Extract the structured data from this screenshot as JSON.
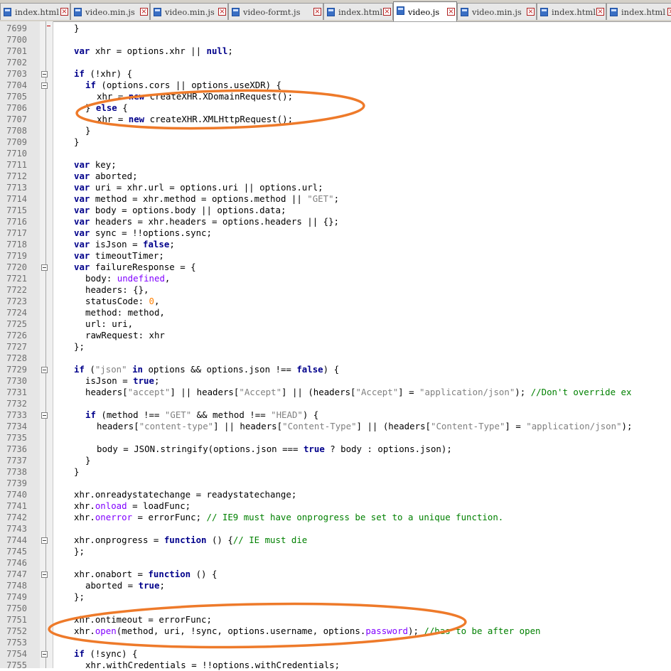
{
  "tabs": [
    {
      "name": "index.html",
      "active": false
    },
    {
      "name": "video.min.js",
      "active": false
    },
    {
      "name": "video.min.js",
      "active": false
    },
    {
      "name": "video-formt.js",
      "active": false
    },
    {
      "name": "index.html",
      "active": false
    },
    {
      "name": "video.js",
      "active": true
    },
    {
      "name": "video.min.js",
      "active": false
    },
    {
      "name": "index.html",
      "active": false
    },
    {
      "name": "index.html",
      "active": false
    }
  ],
  "tab_close_glyph": "×",
  "lines": [
    {
      "n": "7699",
      "indent": 1,
      "tokens": [
        [
          "p",
          "}"
        ]
      ]
    },
    {
      "n": "7700",
      "indent": 0,
      "tokens": []
    },
    {
      "n": "7701",
      "indent": 1,
      "tokens": [
        [
          "k",
          "var"
        ],
        [
          "p",
          " xhr = options.xhr || "
        ],
        [
          "k",
          "null"
        ],
        [
          "p",
          ";"
        ]
      ]
    },
    {
      "n": "7702",
      "indent": 0,
      "tokens": []
    },
    {
      "n": "7703",
      "indent": 1,
      "fold": true,
      "tokens": [
        [
          "k",
          "if"
        ],
        [
          "p",
          " (!xhr) {"
        ]
      ]
    },
    {
      "n": "7704",
      "indent": 2,
      "fold": true,
      "tokens": [
        [
          "k",
          "if"
        ],
        [
          "p",
          " (options.cors || options.useXDR) {"
        ]
      ]
    },
    {
      "n": "7705",
      "indent": 3,
      "tokens": [
        [
          "p",
          "xhr = "
        ],
        [
          "k",
          "new"
        ],
        [
          "p",
          " createXHR.XDomainRequest();"
        ]
      ]
    },
    {
      "n": "7706",
      "indent": 2,
      "tokens": [
        [
          "p",
          "} "
        ],
        [
          "k",
          "else"
        ],
        [
          "p",
          " {"
        ]
      ]
    },
    {
      "n": "7707",
      "indent": 3,
      "tokens": [
        [
          "p",
          "xhr = "
        ],
        [
          "k",
          "new"
        ],
        [
          "p",
          " createXHR.XMLHttpRequest();"
        ]
      ]
    },
    {
      "n": "7708",
      "indent": 2,
      "tokens": [
        [
          "p",
          "}"
        ]
      ]
    },
    {
      "n": "7709",
      "indent": 1,
      "tokens": [
        [
          "p",
          "}"
        ]
      ]
    },
    {
      "n": "7710",
      "indent": 0,
      "tokens": []
    },
    {
      "n": "7711",
      "indent": 1,
      "tokens": [
        [
          "k",
          "var"
        ],
        [
          "p",
          " key;"
        ]
      ]
    },
    {
      "n": "7712",
      "indent": 1,
      "tokens": [
        [
          "k",
          "var"
        ],
        [
          "p",
          " aborted;"
        ]
      ]
    },
    {
      "n": "7713",
      "indent": 1,
      "tokens": [
        [
          "k",
          "var"
        ],
        [
          "p",
          " uri = xhr.url = options.uri || options.url;"
        ]
      ]
    },
    {
      "n": "7714",
      "indent": 1,
      "tokens": [
        [
          "k",
          "var"
        ],
        [
          "p",
          " method = xhr.method = options.method || "
        ],
        [
          "s",
          "\"GET\""
        ],
        [
          "p",
          ";"
        ]
      ]
    },
    {
      "n": "7715",
      "indent": 1,
      "tokens": [
        [
          "k",
          "var"
        ],
        [
          "p",
          " body = options.body || options.data;"
        ]
      ]
    },
    {
      "n": "7716",
      "indent": 1,
      "tokens": [
        [
          "k",
          "var"
        ],
        [
          "p",
          " headers = xhr.headers = options.headers || {};"
        ]
      ]
    },
    {
      "n": "7717",
      "indent": 1,
      "tokens": [
        [
          "k",
          "var"
        ],
        [
          "p",
          " sync = !!options.sync;"
        ]
      ]
    },
    {
      "n": "7718",
      "indent": 1,
      "tokens": [
        [
          "k",
          "var"
        ],
        [
          "p",
          " isJson = "
        ],
        [
          "k",
          "false"
        ],
        [
          "p",
          ";"
        ]
      ]
    },
    {
      "n": "7719",
      "indent": 1,
      "tokens": [
        [
          "k",
          "var"
        ],
        [
          "p",
          " timeoutTimer;"
        ]
      ]
    },
    {
      "n": "7720",
      "indent": 1,
      "fold": true,
      "tokens": [
        [
          "k",
          "var"
        ],
        [
          "p",
          " failureResponse = {"
        ]
      ]
    },
    {
      "n": "7721",
      "indent": 2,
      "tokens": [
        [
          "p",
          "body: "
        ],
        [
          "u",
          "undefined"
        ],
        [
          "p",
          ","
        ]
      ]
    },
    {
      "n": "7722",
      "indent": 2,
      "tokens": [
        [
          "p",
          "headers: {},"
        ]
      ]
    },
    {
      "n": "7723",
      "indent": 2,
      "tokens": [
        [
          "p",
          "statusCode: "
        ],
        [
          "n",
          "0"
        ],
        [
          "p",
          ","
        ]
      ]
    },
    {
      "n": "7724",
      "indent": 2,
      "tokens": [
        [
          "p",
          "method: method,"
        ]
      ]
    },
    {
      "n": "7725",
      "indent": 2,
      "tokens": [
        [
          "p",
          "url: uri,"
        ]
      ]
    },
    {
      "n": "7726",
      "indent": 2,
      "tokens": [
        [
          "p",
          "rawRequest: xhr"
        ]
      ]
    },
    {
      "n": "7727",
      "indent": 1,
      "tokens": [
        [
          "p",
          "};"
        ]
      ]
    },
    {
      "n": "7728",
      "indent": 0,
      "tokens": []
    },
    {
      "n": "7729",
      "indent": 1,
      "fold": true,
      "tokens": [
        [
          "k",
          "if"
        ],
        [
          "p",
          " ("
        ],
        [
          "s",
          "\"json\""
        ],
        [
          "p",
          " "
        ],
        [
          "k",
          "in"
        ],
        [
          "p",
          " options && options.json !== "
        ],
        [
          "k",
          "false"
        ],
        [
          "p",
          ") {"
        ]
      ]
    },
    {
      "n": "7730",
      "indent": 2,
      "tokens": [
        [
          "p",
          "isJson = "
        ],
        [
          "k",
          "true"
        ],
        [
          "p",
          ";"
        ]
      ]
    },
    {
      "n": "7731",
      "indent": 2,
      "tokens": [
        [
          "p",
          "headers["
        ],
        [
          "s",
          "\"accept\""
        ],
        [
          "p",
          "] || headers["
        ],
        [
          "s",
          "\"Accept\""
        ],
        [
          "p",
          "] || (headers["
        ],
        [
          "s",
          "\"Accept\""
        ],
        [
          "p",
          "] = "
        ],
        [
          "s",
          "\"application/json\""
        ],
        [
          "p",
          "); "
        ],
        [
          "c",
          "//Don't override ex"
        ]
      ]
    },
    {
      "n": "7732",
      "indent": 0,
      "tokens": []
    },
    {
      "n": "7733",
      "indent": 2,
      "fold": true,
      "tokens": [
        [
          "k",
          "if"
        ],
        [
          "p",
          " (method !== "
        ],
        [
          "s",
          "\"GET\""
        ],
        [
          "p",
          " && method !== "
        ],
        [
          "s",
          "\"HEAD\""
        ],
        [
          "p",
          ") {"
        ]
      ]
    },
    {
      "n": "7734",
      "indent": 3,
      "tokens": [
        [
          "p",
          "headers["
        ],
        [
          "s",
          "\"content-type\""
        ],
        [
          "p",
          "] || headers["
        ],
        [
          "s",
          "\"Content-Type\""
        ],
        [
          "p",
          "] || (headers["
        ],
        [
          "s",
          "\"Content-Type\""
        ],
        [
          "p",
          "] = "
        ],
        [
          "s",
          "\"application/json\""
        ],
        [
          "p",
          ");"
        ]
      ]
    },
    {
      "n": "7735",
      "indent": 0,
      "tokens": []
    },
    {
      "n": "7736",
      "indent": 3,
      "tokens": [
        [
          "p",
          "body = JSON.stringify(options.json === "
        ],
        [
          "k",
          "true"
        ],
        [
          "p",
          " ? body : options.json);"
        ]
      ]
    },
    {
      "n": "7737",
      "indent": 2,
      "tokens": [
        [
          "p",
          "}"
        ]
      ]
    },
    {
      "n": "7738",
      "indent": 1,
      "tokens": [
        [
          "p",
          "}"
        ]
      ]
    },
    {
      "n": "7739",
      "indent": 0,
      "tokens": []
    },
    {
      "n": "7740",
      "indent": 1,
      "tokens": [
        [
          "p",
          "xhr.onreadystatechange = readystatechange;"
        ]
      ]
    },
    {
      "n": "7741",
      "indent": 1,
      "tokens": [
        [
          "p",
          "xhr."
        ],
        [
          "u",
          "onload"
        ],
        [
          "p",
          " = loadFunc;"
        ]
      ]
    },
    {
      "n": "7742",
      "indent": 1,
      "tokens": [
        [
          "p",
          "xhr."
        ],
        [
          "u",
          "onerror"
        ],
        [
          "p",
          " = errorFunc; "
        ],
        [
          "c",
          "// IE9 must have onprogress be set to a unique function."
        ]
      ]
    },
    {
      "n": "7743",
      "indent": 0,
      "tokens": []
    },
    {
      "n": "7744",
      "indent": 1,
      "fold": true,
      "tokens": [
        [
          "p",
          "xhr.onprogress = "
        ],
        [
          "k",
          "function"
        ],
        [
          "p",
          " () {"
        ],
        [
          "c",
          "// IE must die"
        ]
      ]
    },
    {
      "n": "7745",
      "indent": 1,
      "tokens": [
        [
          "p",
          "};"
        ]
      ]
    },
    {
      "n": "7746",
      "indent": 0,
      "tokens": []
    },
    {
      "n": "7747",
      "indent": 1,
      "fold": true,
      "tokens": [
        [
          "p",
          "xhr.onabort = "
        ],
        [
          "k",
          "function"
        ],
        [
          "p",
          " () {"
        ]
      ]
    },
    {
      "n": "7748",
      "indent": 2,
      "tokens": [
        [
          "p",
          "aborted = "
        ],
        [
          "k",
          "true"
        ],
        [
          "p",
          ";"
        ]
      ]
    },
    {
      "n": "7749",
      "indent": 1,
      "tokens": [
        [
          "p",
          "};"
        ]
      ]
    },
    {
      "n": "7750",
      "indent": 0,
      "tokens": []
    },
    {
      "n": "7751",
      "indent": 1,
      "tokens": [
        [
          "p",
          "xhr.ontimeout = errorFunc;"
        ]
      ]
    },
    {
      "n": "7752",
      "indent": 1,
      "tokens": [
        [
          "p",
          "xhr."
        ],
        [
          "u",
          "open"
        ],
        [
          "p",
          "(method, uri, !sync, options.username, options."
        ],
        [
          "u",
          "password"
        ],
        [
          "p",
          "); "
        ],
        [
          "c",
          "//has to be after open"
        ]
      ]
    },
    {
      "n": "7753",
      "indent": 0,
      "tokens": []
    },
    {
      "n": "7754",
      "indent": 1,
      "fold": true,
      "tokens": [
        [
          "k",
          "if"
        ],
        [
          "p",
          " (!sync) {"
        ]
      ]
    },
    {
      "n": "7755",
      "indent": 2,
      "tokens": [
        [
          "p",
          "xhr.withCredentials = !!options.withCredentials;"
        ]
      ]
    }
  ],
  "annotations": {
    "ellipse_color": "#ee7a2a"
  }
}
